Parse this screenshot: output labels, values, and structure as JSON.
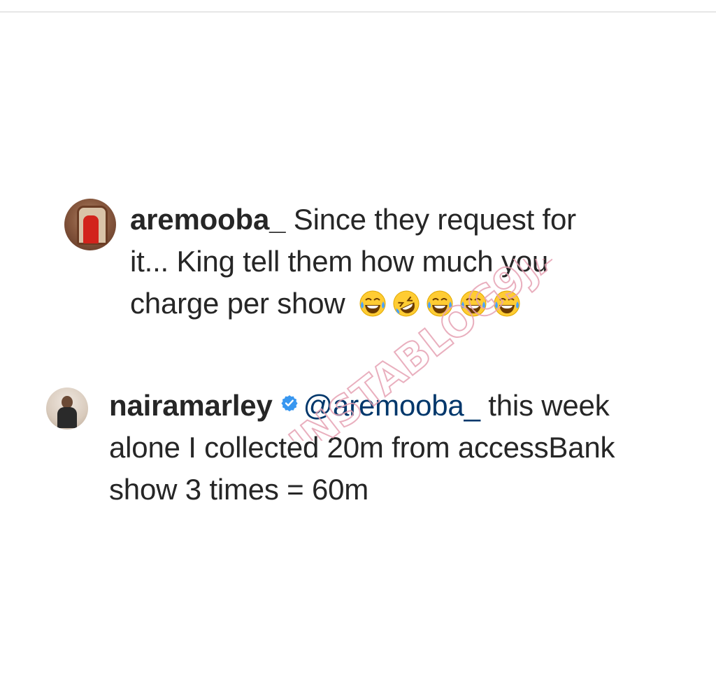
{
  "comments": [
    {
      "username": "aremooba_",
      "text": "Since they request for it... King tell them how much you charge per show",
      "emojis": [
        "face-with-tears-of-joy",
        "rolling-on-the-floor-laughing",
        "face-with-tears-of-joy",
        "face-with-tears-of-joy",
        "face-with-tears-of-joy"
      ]
    },
    {
      "username": "nairamarley",
      "verified": true,
      "mention": "@aremooba_",
      "text": "this week alone I collected 20m from accessBank show 3 times = 60m"
    }
  ],
  "watermark": {
    "text": "INSTABLOG9JA"
  },
  "colors": {
    "text": "#262626",
    "mention": "#00376b",
    "verified": "#3897f0",
    "watermark": "#e6a2b3"
  }
}
